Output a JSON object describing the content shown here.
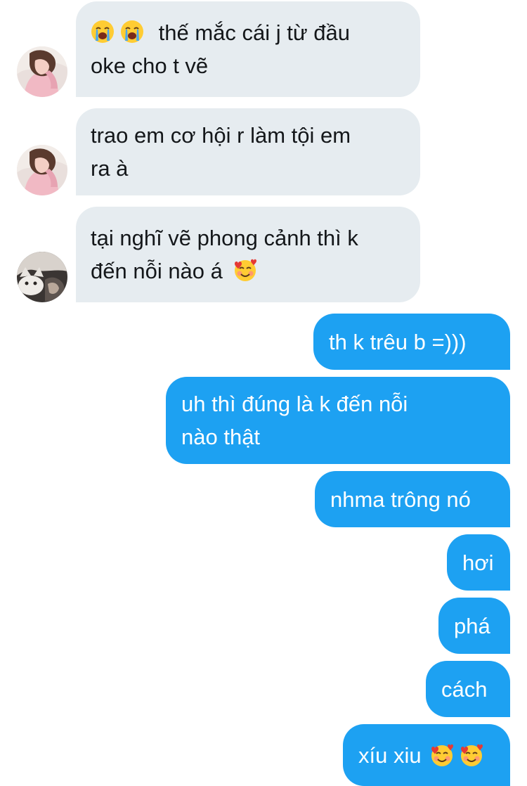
{
  "conversation": {
    "incoming": [
      {
        "avatar": "pink-sweater-photo-avatar",
        "leading_emojis": [
          "loudly-crying-face-icon",
          "loudly-crying-face-icon"
        ],
        "line1": "thế mắc cái j từ đầu",
        "line2": "oke cho t vẽ"
      },
      {
        "avatar": "pink-sweater-photo-avatar",
        "line1": "trao em cơ hội r làm tội em",
        "line2": "ra à"
      },
      {
        "avatar": "cat-photo-avatar",
        "line1": "tại nghĩ vẽ phong cảnh thì k",
        "line2": "đến nỗi nào á",
        "trailing_emojis": [
          "smiling-face-with-hearts-icon"
        ]
      }
    ],
    "outgoing": [
      {
        "text": "th k trêu b =)))"
      },
      {
        "line1": "uh thì đúng là k đến nỗi",
        "line2": "nào thật"
      },
      {
        "text": "nhma trông nó"
      },
      {
        "text": "hơi"
      },
      {
        "text": "phá"
      },
      {
        "text": "cách"
      },
      {
        "text": "xíu xiu",
        "trailing_emojis": [
          "smiling-face-with-hearts-icon",
          "smiling-face-with-hearts-icon"
        ]
      }
    ]
  },
  "colors": {
    "incoming_bubble": "#e6ecf0",
    "incoming_text": "#14171a",
    "outgoing_bubble": "#1da1f2",
    "outgoing_text": "#ffffff"
  }
}
